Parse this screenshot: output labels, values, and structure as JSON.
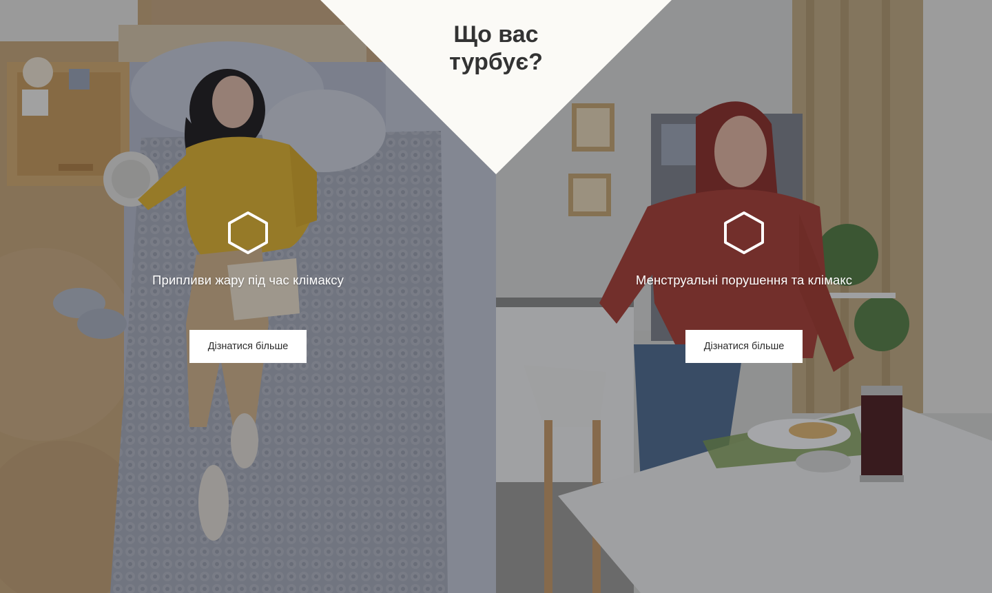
{
  "heading": {
    "line1": "Що вас",
    "line2": "турбує?"
  },
  "panels": [
    {
      "title": "Припливи жару під час клімаксу",
      "button_label": "Дізнатися більше",
      "icon": "hexagon-icon"
    },
    {
      "title": "Менструальні порушення та клімакс",
      "button_label": "Дізнатися більше",
      "icon": "hexagon-icon"
    }
  ],
  "colors": {
    "triangle": "#fbfaf6",
    "heading": "#333333",
    "button_bg": "#ffffff",
    "button_text": "#2b2b2b",
    "overlay": "#191c24"
  }
}
